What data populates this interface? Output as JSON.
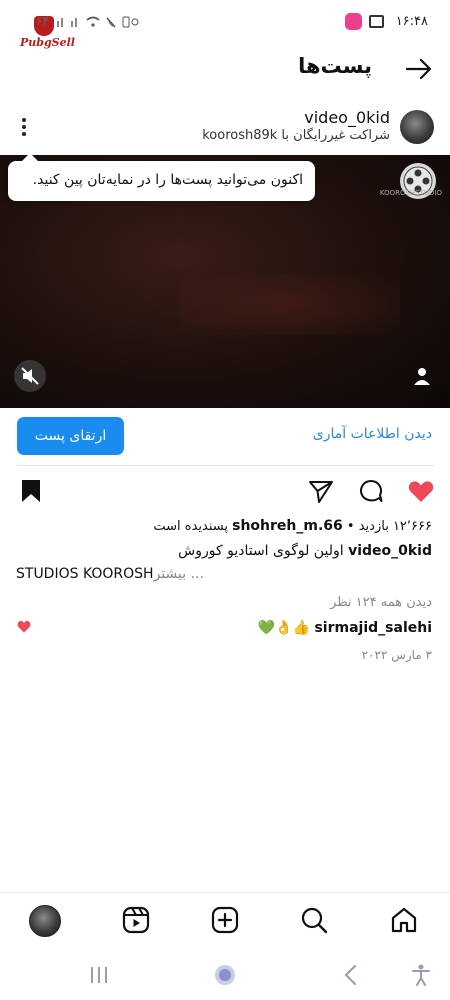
{
  "status_bar": {
    "time": "۱۶:۴۸",
    "left_indicators": "۶۴",
    "logo_text": "PubgSell"
  },
  "header": {
    "title": "پست‌ها"
  },
  "post": {
    "username": "video_0kid",
    "subtitle": "شراکت غیررایگان با koorosh89k"
  },
  "video": {
    "logo_text": "KOOROSHSTUDIO"
  },
  "tooltip": {
    "text": "اکنون می‌توانید پست‌ها را در نمایه‌تان پین کنید."
  },
  "actions": {
    "insights_label": "دیدن اطلاعات آماری",
    "boost_label": "ارتقای پست"
  },
  "stats": {
    "views": "۱۲٬۶۶۶ بازدید",
    "separator": "•",
    "liker": "shohreh_m.66",
    "liked_text": "پسندیده است"
  },
  "caption": {
    "username": "video_0kid",
    "text": "اولین لوگوی استادیو کوروش",
    "line2": "STUDIOS KOOROSH",
    "more_label": "بیشتر ..."
  },
  "comments": {
    "view_all": "دیدن همه ۱۲۴ نظر",
    "top_comment_user": "sirmajid_salehi",
    "top_comment_text": "👍👌💚"
  },
  "post_date": "۳ مارس ۲۰۲۲",
  "colors": {
    "accent_blue": "#1a8cf0",
    "link_blue": "#2e86de",
    "like_red": "#ed4956"
  },
  "icons": {
    "header": "arrow-right-icon",
    "post_menu": "more-vertical-icon",
    "like": "heart-filled-icon",
    "comment": "comment-icon",
    "share": "send-icon",
    "save": "bookmark-filled-icon",
    "nav": [
      "home-icon",
      "search-icon",
      "add-icon",
      "reels-icon",
      "profile-avatar"
    ]
  }
}
